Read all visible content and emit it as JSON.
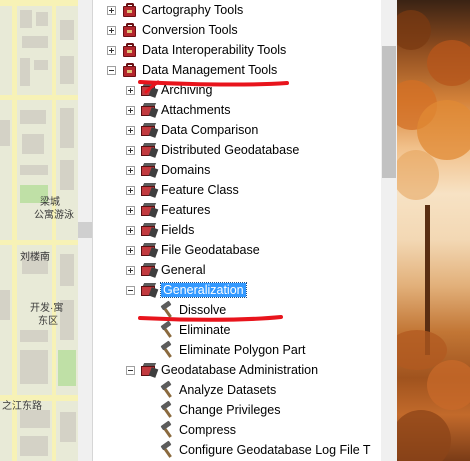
{
  "map": {
    "labels": [
      "梁城",
      "公寓游泳",
      "刘楼南",
      "东区",
      "开发·寓",
      "之江东路"
    ]
  },
  "tree": {
    "items": [
      {
        "label": "Cartography Tools",
        "expander": "plus",
        "icon": "toolbox-icon"
      },
      {
        "label": "Conversion Tools",
        "expander": "plus",
        "icon": "toolbox-icon"
      },
      {
        "label": "Data Interoperability Tools",
        "expander": "plus",
        "icon": "toolbox-icon"
      },
      {
        "label": "Data Management Tools",
        "expander": "minus",
        "icon": "toolbox-icon"
      },
      {
        "label": "Archiving",
        "expander": "plus",
        "icon": "toolset-icon"
      },
      {
        "label": "Attachments",
        "expander": "plus",
        "icon": "toolset-icon"
      },
      {
        "label": "Data Comparison",
        "expander": "plus",
        "icon": "toolset-icon"
      },
      {
        "label": "Distributed Geodatabase",
        "expander": "plus",
        "icon": "toolset-icon"
      },
      {
        "label": "Domains",
        "expander": "plus",
        "icon": "toolset-icon"
      },
      {
        "label": "Feature Class",
        "expander": "plus",
        "icon": "toolset-icon"
      },
      {
        "label": "Features",
        "expander": "plus",
        "icon": "toolset-icon"
      },
      {
        "label": "Fields",
        "expander": "plus",
        "icon": "toolset-icon"
      },
      {
        "label": "File Geodatabase",
        "expander": "plus",
        "icon": "toolset-icon"
      },
      {
        "label": "General",
        "expander": "plus",
        "icon": "toolset-icon"
      },
      {
        "label": "Generalization",
        "expander": "minus",
        "icon": "toolset-icon",
        "selected": true
      },
      {
        "label": "Dissolve",
        "expander": "none",
        "icon": "hammer-icon"
      },
      {
        "label": "Eliminate",
        "expander": "none",
        "icon": "hammer-icon"
      },
      {
        "label": "Eliminate Polygon Part",
        "expander": "none",
        "icon": "hammer-icon"
      },
      {
        "label": "Geodatabase Administration",
        "expander": "minus",
        "icon": "toolset-icon"
      },
      {
        "label": "Analyze Datasets",
        "expander": "none",
        "icon": "hammer-icon"
      },
      {
        "label": "Change Privileges",
        "expander": "none",
        "icon": "hammer-icon"
      },
      {
        "label": "Compress",
        "expander": "none",
        "icon": "hammer-icon"
      },
      {
        "label": "Configure Geodatabase Log File T",
        "expander": "none",
        "icon": "hammer-icon"
      }
    ]
  },
  "colors": {
    "selection": "#3399ff",
    "annotation": "#e8141c",
    "toolbox": "#b3262d"
  }
}
